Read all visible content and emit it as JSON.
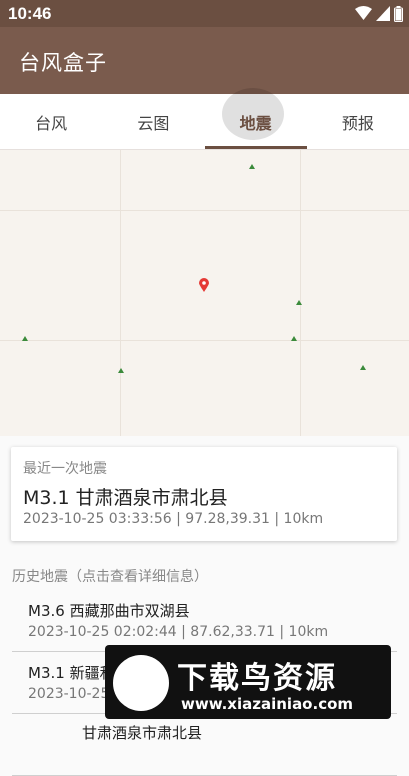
{
  "status_bar": {
    "time": "10:46",
    "icons": [
      "wifi-icon",
      "signal-icon",
      "battery-icon"
    ]
  },
  "app": {
    "title": "台风盒子"
  },
  "tabs": [
    {
      "label": "台风",
      "active": false
    },
    {
      "label": "云图",
      "active": false
    },
    {
      "label": "地震",
      "active": true
    },
    {
      "label": "预报",
      "active": false
    }
  ],
  "latest": {
    "label": "最近一次地震",
    "title": "M3.1 甘肃酒泉市肃北县",
    "meta": "2023-10-25 03:33:56 | 97.28,39.31 | 10km"
  },
  "history": {
    "header": "历史地震（点击查看详细信息）",
    "items": [
      {
        "title": "M3.6 西藏那曲市双湖县",
        "meta": "2023-10-25 02:02:44 | 87.62,33.71 | 10km"
      },
      {
        "title": "M3.1 新疆和",
        "meta": "2023-10-25"
      },
      {
        "title": "甘肃酒泉市肃北县",
        "meta": ""
      }
    ]
  },
  "watermark": {
    "title": "下载鸟资源",
    "url": "www.xiazainiao.com"
  },
  "colors": {
    "status_bar": "#6b4f41",
    "app_bar": "#7a5b4d",
    "accent": "#6b4f41",
    "pin": "#e53935"
  }
}
